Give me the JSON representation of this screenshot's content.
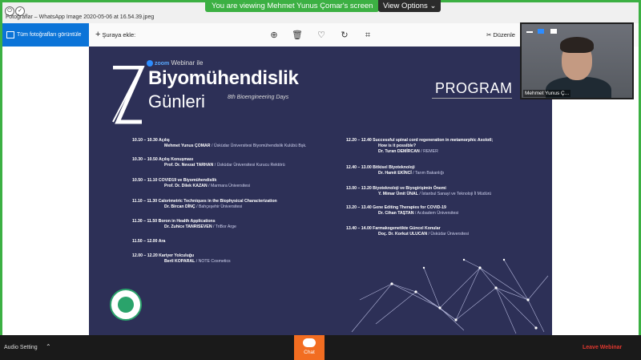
{
  "window": {
    "title": "Fotoğraflar – WhatsApp Image 2020-05-06 at 16.54.39.jpeg",
    "ctl_1": "⏻",
    "ctl_2": "✓"
  },
  "share_banner": {
    "viewing_text": "You are viewing Mehmet Yunus Çomar's screen",
    "view_options": "View Options"
  },
  "photos_toolbar": {
    "all_photos": "Tüm fotoğrafları görüntüle",
    "add_to": "Şuraya ekle:",
    "edit": "Düzenle"
  },
  "poster": {
    "zoom_word": "zoom",
    "webinar_label": "Webinar ile",
    "title_main": "Biyomühendislik",
    "title_second": "Günleri",
    "subtitle": "8th Bioengineering Days",
    "program_heading": "PROGRAM",
    "left_entries": [
      {
        "time_title": "10.10 – 10.30 Açılış",
        "speaker": "Mehmet Yunus ÇOMAR",
        "affil": " / Üsküdar Üniversitesi Biyomühendislik Kulübü Bşk."
      },
      {
        "time_title": "10.30 – 10.50 Açılış Konuşması",
        "speaker": "Prof. Dr. Nevzat TARHAN",
        "affil": " / Üsküdar Üniversitesi Kurucu Rektörü"
      },
      {
        "time_title": "10.50 – 11.10 COVID19 ve Biyomühendislik",
        "speaker": "Prof. Dr. Dilek KAZAN",
        "affil": " / Marmara Üniversitesi"
      },
      {
        "time_title": "11.10 – 11.30 Calorimetric Techniques in the Biophysical Characterization",
        "speaker": "Dr. Bircan DİNÇ",
        "affil": " / Bahçeşehir Üniversitesi"
      },
      {
        "time_title": "11.30 – 11.50 Boron in Health Applications",
        "speaker": "Dr. Zuhice TANRISEVEN",
        "affil": " / TriBor Arge"
      },
      {
        "time_title": "11.50 – 12.00 Ara",
        "speaker": "",
        "affil": ""
      },
      {
        "time_title": "12.00 – 12.20 Kariyer Yolculuğu",
        "speaker": "Beril KOPARAL",
        "affil": " / NOTE Cosmetics"
      }
    ],
    "right_entries": [
      {
        "time_title": "12.20 – 12.40 Successful spinal cord regeneration in metamorphic Axolotl;",
        "line2": "How is it possible?",
        "speaker": "Dr. Turan DEMİRCAN",
        "affil": " / REMER"
      },
      {
        "time_title": "12.40 – 13.00 Bitkisel Biyoteknoloji",
        "line2": "",
        "speaker": "Dr. Hamit EKİNCİ",
        "affil": " / Tarım Bakanlığı"
      },
      {
        "time_title": "13.00 – 13.20 Biyoteknoloji ve Biyogirişimin Önemi",
        "line2": "",
        "speaker": "Y. Mimar Ümit ÜNAL",
        "affil": " / İstanbul Sanayi ve Teknoloji İl Müdürü"
      },
      {
        "time_title": "13.20 – 13.40 Gene Editing Therapies for COVID-19",
        "line2": "",
        "speaker": "Dr. Cihan TAŞTAN",
        "affil": " / Acıbadem Üniversitesi"
      },
      {
        "time_title": "13.40 – 14.00 Farmakogenetikte Güncel Konular",
        "line2": "",
        "speaker": "Doç. Dr. Korkut ULUCAN",
        "affil": " / Üsküdar Üniversitesi"
      }
    ]
  },
  "webcam": {
    "participant_name": "Mehmet Yunus Ç..."
  },
  "bottom_bar": {
    "audio_setting": "Audio Setting",
    "chat": "Chat",
    "leave": "Leave Webinar"
  },
  "colors": {
    "share_green": "#3cb043",
    "poster_bg": "#2d3057",
    "photos_blue": "#0b74d8",
    "chat_orange": "#f26d21",
    "leave_red": "#e0382f"
  }
}
